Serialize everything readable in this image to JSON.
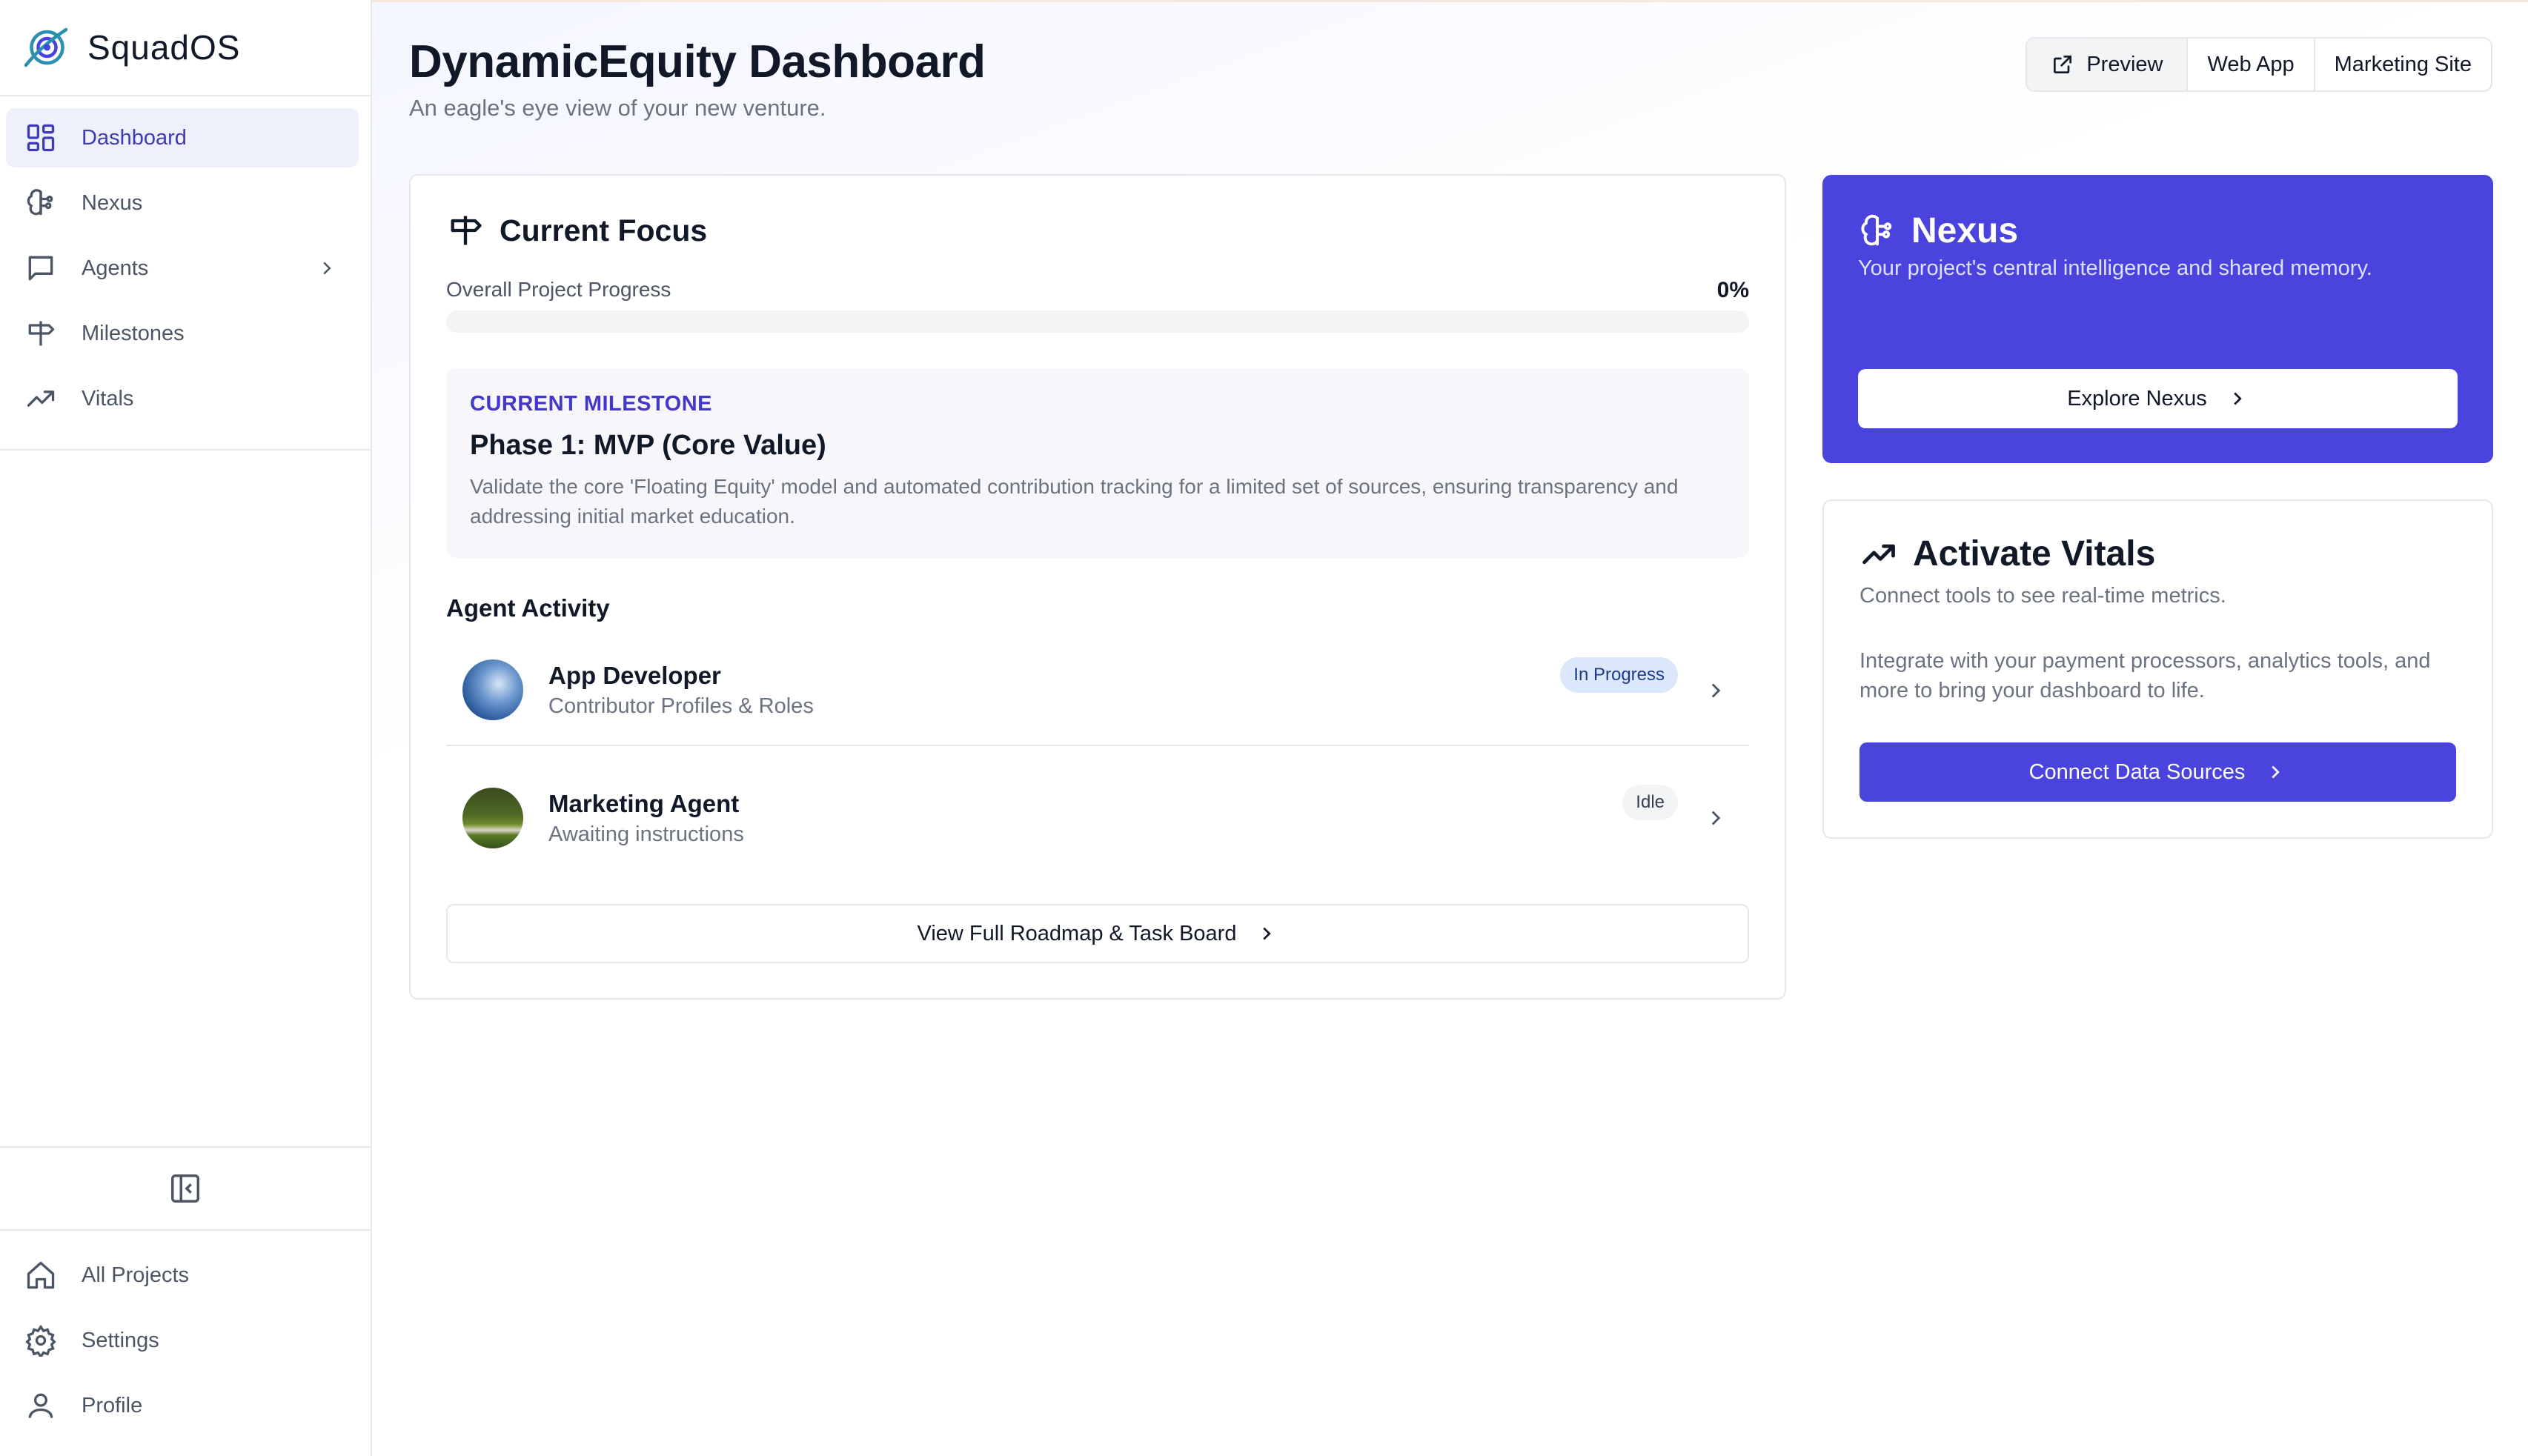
{
  "brand": {
    "name": "SquadOS"
  },
  "sidebar": {
    "items": [
      {
        "label": "Dashboard",
        "icon": "dashboard-icon",
        "active": true
      },
      {
        "label": "Nexus",
        "icon": "brain-icon"
      },
      {
        "label": "Agents",
        "icon": "chat-icon",
        "has_submenu": true
      },
      {
        "label": "Milestones",
        "icon": "signpost-icon"
      },
      {
        "label": "Vitals",
        "icon": "trending-up-icon"
      }
    ],
    "bottom": [
      {
        "label": "All Projects",
        "icon": "home-icon"
      },
      {
        "label": "Settings",
        "icon": "gear-icon"
      },
      {
        "label": "Profile",
        "icon": "user-icon"
      }
    ]
  },
  "header": {
    "title": "DynamicEquity Dashboard",
    "subtitle": "An eagle's eye view of your new venture.",
    "links": [
      "Preview",
      "Web App",
      "Marketing Site"
    ]
  },
  "focus": {
    "title": "Current Focus",
    "progress_label": "Overall Project Progress",
    "progress_value": "0%",
    "progress_fraction": 0,
    "milestone": {
      "kicker": "CURRENT MILESTONE",
      "title": "Phase 1: MVP (Core Value)",
      "description": "Validate the core 'Floating Equity' model and automated contribution tracking for a limited set of sources, ensuring transparency and addressing initial market education."
    },
    "activity_title": "Agent Activity",
    "agents": [
      {
        "name": "App Developer",
        "task": "Contributor Profiles & Roles",
        "status": "In Progress"
      },
      {
        "name": "Marketing Agent",
        "task": "Awaiting instructions",
        "status": "Idle"
      }
    ],
    "roadmap_button": "View Full Roadmap & Task Board"
  },
  "nexus": {
    "title": "Nexus",
    "subtitle": "Your project's central intelligence and shared memory.",
    "button": "Explore Nexus"
  },
  "vitals": {
    "title": "Activate Vitals",
    "subtitle": "Connect tools to see real-time metrics.",
    "description": "Integrate with your payment processors, analytics tools, and more to bring your dashboard to life.",
    "button": "Connect Data Sources"
  },
  "colors": {
    "accent": "#4a43dd",
    "active_nav_bg": "#eef0fb",
    "active_nav_text": "#3f3bb5"
  }
}
